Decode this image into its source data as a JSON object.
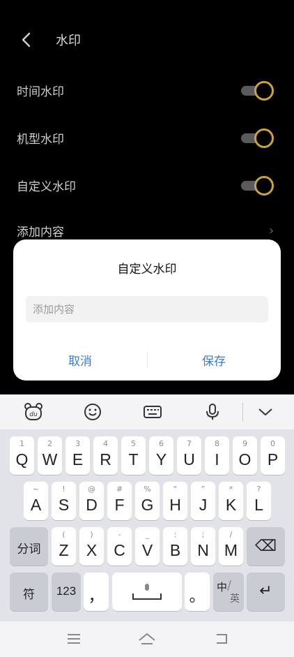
{
  "header": {
    "title": "水印"
  },
  "settings": {
    "rows": [
      {
        "label": "时间水印",
        "enabled": true
      },
      {
        "label": "机型水印",
        "enabled": true
      },
      {
        "label": "自定义水印",
        "enabled": true
      }
    ],
    "add_content": {
      "label": "添加内容"
    }
  },
  "colors": {
    "toggle_accent": "#c9a43c",
    "dialog_button": "#3a7bd5"
  },
  "dialog": {
    "title": "自定义水印",
    "input": {
      "placeholder": "添加内容",
      "value": ""
    },
    "cancel_label": "取消",
    "save_label": "保存"
  },
  "keyboard": {
    "toolbar": {
      "icons": [
        "du-bear-icon",
        "emoji-icon",
        "keyboard-icon",
        "microphone-icon",
        "collapse-chevron-icon"
      ]
    },
    "rows": [
      [
        {
          "k": "Q",
          "h": "1"
        },
        {
          "k": "W",
          "h": "2"
        },
        {
          "k": "E",
          "h": "3"
        },
        {
          "k": "R",
          "h": "4"
        },
        {
          "k": "T",
          "h": "5"
        },
        {
          "k": "Y",
          "h": "6"
        },
        {
          "k": "U",
          "h": "7"
        },
        {
          "k": "I",
          "h": "8"
        },
        {
          "k": "O",
          "h": "9"
        },
        {
          "k": "P",
          "h": "0"
        }
      ],
      [
        {
          "k": "A",
          "h": "~"
        },
        {
          "k": "S",
          "h": "!"
        },
        {
          "k": "D",
          "h": "@"
        },
        {
          "k": "F",
          "h": "#"
        },
        {
          "k": "G",
          "h": "%"
        },
        {
          "k": "H",
          "h": "“"
        },
        {
          "k": "J",
          "h": "”"
        },
        {
          "k": "K",
          "h": "*"
        },
        {
          "k": "L",
          "h": "?"
        }
      ],
      [
        {
          "k": "Z",
          "h": "("
        },
        {
          "k": "X",
          "h": ")"
        },
        {
          "k": "C",
          "h": "-"
        },
        {
          "k": "V",
          "h": "_"
        },
        {
          "k": "B",
          "h": ":"
        },
        {
          "k": "N",
          "h": ";"
        },
        {
          "k": "M",
          "h": "/"
        }
      ]
    ],
    "fenci_label": "分词",
    "backspace_label": "⌫",
    "fu_label": "符",
    "num_label": "123",
    "comma_label": "，",
    "period_label": "。",
    "lang_zh": "中",
    "lang_en": "英",
    "enter_label": "↵"
  },
  "navbar": {
    "icons": [
      "menu-icon",
      "home-icon",
      "back-icon"
    ]
  }
}
